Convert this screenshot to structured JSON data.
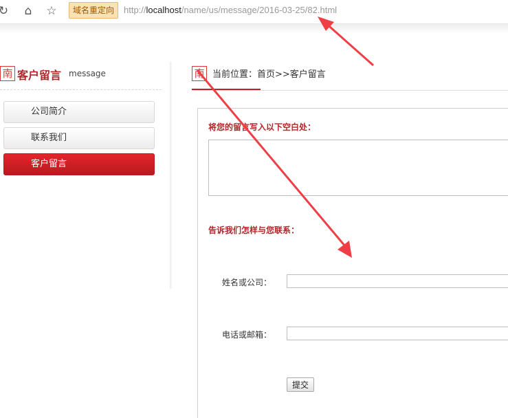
{
  "browser": {
    "refresh_icon": "refresh-icon",
    "home_icon": "home-icon",
    "star_icon": "star-icon",
    "badge": "域名重定向",
    "url_scheme": "http://",
    "url_host": "localhost",
    "url_path": "/name/us/message/2016-03-25/82.html"
  },
  "sidebar": {
    "logo_glyph": "南",
    "title": "客户留言",
    "subtitle": "message",
    "items": [
      {
        "label": "公司简介",
        "active": false
      },
      {
        "label": "联系我们",
        "active": false
      },
      {
        "label": "客户留言",
        "active": true
      }
    ]
  },
  "breadcrumb": {
    "logo_glyph": "南",
    "prefix": "当前位置：",
    "path": "首页>>客户留言"
  },
  "form": {
    "message_prompt": "将您的留言写入以下空白处：",
    "contact_prompt": "告诉我们怎样与您联系：",
    "name_label": "姓名或公司：",
    "contact_label": "电话或邮箱：",
    "submit_label": "提交"
  },
  "colors": {
    "accent": "#b2262a",
    "active_menu": "#d8202a",
    "annotation_arrow": "#ef3f46",
    "badge_bg": "#fbe2b5"
  }
}
